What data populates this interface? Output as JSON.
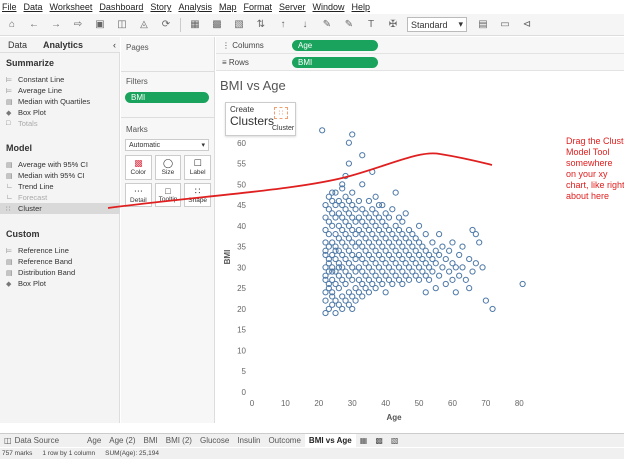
{
  "menu": [
    "File",
    "Data",
    "Worksheet",
    "Dashboard",
    "Story",
    "Analysis",
    "Map",
    "Format",
    "Server",
    "Window",
    "Help"
  ],
  "toolbar": {
    "fit_select": "Standard"
  },
  "left_tabs": {
    "data": "Data",
    "analytics": "Analytics"
  },
  "summarize": {
    "title": "Summarize",
    "items": [
      "Constant Line",
      "Average Line",
      "Median with Quartiles",
      "Box Plot",
      "Totals"
    ]
  },
  "model": {
    "title": "Model",
    "items": [
      "Average with 95% CI",
      "Median with 95% CI",
      "Trend Line",
      "Forecast",
      "Cluster"
    ]
  },
  "custom": {
    "title": "Custom",
    "items": [
      "Reference Line",
      "Reference Band",
      "Distribution Band",
      "Box Plot"
    ]
  },
  "pages": {
    "title": "Pages"
  },
  "filters": {
    "title": "Filters",
    "pill": "BMI"
  },
  "marks": {
    "title": "Marks",
    "type": "Automatic",
    "buttons": [
      "Color",
      "Size",
      "Label",
      "Detail",
      "Tooltip",
      "Shape"
    ]
  },
  "shelves": {
    "columns_label": "Columns",
    "columns_pill": "Age",
    "rows_label": "Rows",
    "rows_pill": "BMI"
  },
  "viz": {
    "title": "BMI vs Age",
    "drop_target": {
      "line1": "Create",
      "line2": "Clusters",
      "label": "Cluster"
    },
    "annotation": [
      "Drag the Cluster",
      "Model Tool",
      "somewhere",
      "on your xy",
      "chart, like right",
      "about here"
    ],
    "annotation_color": "#e02020",
    "mark_color": "#4e79a7"
  },
  "chart_data": {
    "type": "scatter",
    "title": "BMI vs Age",
    "xlabel": "Age",
    "ylabel": "BMI",
    "xlim": [
      0,
      85
    ],
    "ylim": [
      0,
      65
    ],
    "xticks": [
      0,
      10,
      20,
      30,
      40,
      50,
      60,
      70,
      80
    ],
    "yticks": [
      0,
      5,
      10,
      15,
      20,
      25,
      30,
      35,
      40,
      45,
      50,
      55,
      60
    ],
    "grid": false,
    "points": [
      [
        22,
        19
      ],
      [
        22,
        24
      ],
      [
        22,
        27
      ],
      [
        22,
        30
      ],
      [
        22,
        33
      ],
      [
        22,
        36
      ],
      [
        22,
        39
      ],
      [
        22,
        42
      ],
      [
        22,
        45
      ],
      [
        22,
        22
      ],
      [
        22,
        28
      ],
      [
        22,
        34
      ],
      [
        23,
        20
      ],
      [
        23,
        25
      ],
      [
        23,
        29
      ],
      [
        23,
        32
      ],
      [
        23,
        35
      ],
      [
        23,
        38
      ],
      [
        23,
        41
      ],
      [
        23,
        44
      ],
      [
        23,
        47
      ],
      [
        23,
        26
      ],
      [
        23,
        31
      ],
      [
        24,
        21
      ],
      [
        24,
        24
      ],
      [
        24,
        27
      ],
      [
        24,
        30
      ],
      [
        24,
        33
      ],
      [
        24,
        36
      ],
      [
        24,
        40
      ],
      [
        24,
        43
      ],
      [
        24,
        46
      ],
      [
        24,
        23
      ],
      [
        24,
        29
      ],
      [
        25,
        19
      ],
      [
        25,
        22
      ],
      [
        25,
        26
      ],
      [
        25,
        29
      ],
      [
        25,
        32
      ],
      [
        25,
        35
      ],
      [
        25,
        38
      ],
      [
        25,
        42
      ],
      [
        25,
        45
      ],
      [
        25,
        48
      ],
      [
        25,
        34
      ],
      [
        26,
        21
      ],
      [
        26,
        25
      ],
      [
        26,
        28
      ],
      [
        26,
        31
      ],
      [
        26,
        34
      ],
      [
        26,
        37
      ],
      [
        26,
        40
      ],
      [
        26,
        43
      ],
      [
        26,
        46
      ],
      [
        26,
        30
      ],
      [
        27,
        20
      ],
      [
        27,
        23
      ],
      [
        27,
        27
      ],
      [
        27,
        30
      ],
      [
        27,
        33
      ],
      [
        27,
        36
      ],
      [
        27,
        39
      ],
      [
        27,
        42
      ],
      [
        27,
        45
      ],
      [
        27,
        49
      ],
      [
        28,
        22
      ],
      [
        28,
        26
      ],
      [
        28,
        29
      ],
      [
        28,
        32
      ],
      [
        28,
        35
      ],
      [
        28,
        38
      ],
      [
        28,
        41
      ],
      [
        28,
        44
      ],
      [
        28,
        47
      ],
      [
        28,
        52
      ],
      [
        29,
        21
      ],
      [
        29,
        24
      ],
      [
        29,
        28
      ],
      [
        29,
        31
      ],
      [
        29,
        34
      ],
      [
        29,
        37
      ],
      [
        29,
        40
      ],
      [
        29,
        43
      ],
      [
        29,
        46
      ],
      [
        30,
        20
      ],
      [
        30,
        23
      ],
      [
        30,
        27
      ],
      [
        30,
        30
      ],
      [
        30,
        33
      ],
      [
        30,
        36
      ],
      [
        30,
        39
      ],
      [
        30,
        42
      ],
      [
        30,
        45
      ],
      [
        30,
        48
      ],
      [
        31,
        22
      ],
      [
        31,
        25
      ],
      [
        31,
        29
      ],
      [
        31,
        32
      ],
      [
        31,
        35
      ],
      [
        31,
        38
      ],
      [
        31,
        41
      ],
      [
        31,
        44
      ],
      [
        32,
        24
      ],
      [
        32,
        27
      ],
      [
        32,
        30
      ],
      [
        32,
        33
      ],
      [
        32,
        36
      ],
      [
        32,
        39
      ],
      [
        32,
        42
      ],
      [
        32,
        46
      ],
      [
        33,
        23
      ],
      [
        33,
        26
      ],
      [
        33,
        29
      ],
      [
        33,
        32
      ],
      [
        33,
        35
      ],
      [
        33,
        38
      ],
      [
        33,
        41
      ],
      [
        33,
        44
      ],
      [
        33,
        50
      ],
      [
        34,
        25
      ],
      [
        34,
        28
      ],
      [
        34,
        31
      ],
      [
        34,
        34
      ],
      [
        34,
        37
      ],
      [
        34,
        40
      ],
      [
        34,
        43
      ],
      [
        35,
        24
      ],
      [
        35,
        27
      ],
      [
        35,
        30
      ],
      [
        35,
        33
      ],
      [
        35,
        36
      ],
      [
        35,
        39
      ],
      [
        35,
        42
      ],
      [
        35,
        46
      ],
      [
        36,
        26
      ],
      [
        36,
        29
      ],
      [
        36,
        32
      ],
      [
        36,
        35
      ],
      [
        36,
        38
      ],
      [
        36,
        41
      ],
      [
        36,
        44
      ],
      [
        37,
        25
      ],
      [
        37,
        28
      ],
      [
        37,
        31
      ],
      [
        37,
        34
      ],
      [
        37,
        37
      ],
      [
        37,
        40
      ],
      [
        37,
        43
      ],
      [
        37,
        47
      ],
      [
        38,
        27
      ],
      [
        38,
        30
      ],
      [
        38,
        33
      ],
      [
        38,
        36
      ],
      [
        38,
        39
      ],
      [
        38,
        42
      ],
      [
        39,
        26
      ],
      [
        39,
        29
      ],
      [
        39,
        32
      ],
      [
        39,
        35
      ],
      [
        39,
        38
      ],
      [
        39,
        41
      ],
      [
        39,
        45
      ],
      [
        40,
        24
      ],
      [
        40,
        28
      ],
      [
        40,
        31
      ],
      [
        40,
        34
      ],
      [
        40,
        37
      ],
      [
        40,
        40
      ],
      [
        40,
        43
      ],
      [
        41,
        27
      ],
      [
        41,
        30
      ],
      [
        41,
        33
      ],
      [
        41,
        36
      ],
      [
        41,
        39
      ],
      [
        41,
        42
      ],
      [
        42,
        26
      ],
      [
        42,
        29
      ],
      [
        42,
        32
      ],
      [
        42,
        35
      ],
      [
        42,
        38
      ],
      [
        42,
        44
      ],
      [
        43,
        28
      ],
      [
        43,
        31
      ],
      [
        43,
        34
      ],
      [
        43,
        37
      ],
      [
        43,
        40
      ],
      [
        44,
        27
      ],
      [
        44,
        30
      ],
      [
        44,
        33
      ],
      [
        44,
        36
      ],
      [
        44,
        39
      ],
      [
        44,
        42
      ],
      [
        45,
        26
      ],
      [
        45,
        29
      ],
      [
        45,
        32
      ],
      [
        45,
        35
      ],
      [
        45,
        38
      ],
      [
        45,
        41
      ],
      [
        46,
        28
      ],
      [
        46,
        31
      ],
      [
        46,
        34
      ],
      [
        46,
        37
      ],
      [
        46,
        43
      ],
      [
        47,
        27
      ],
      [
        47,
        30
      ],
      [
        47,
        33
      ],
      [
        47,
        36
      ],
      [
        47,
        39
      ],
      [
        48,
        29
      ],
      [
        48,
        32
      ],
      [
        48,
        35
      ],
      [
        48,
        38
      ],
      [
        49,
        28
      ],
      [
        49,
        31
      ],
      [
        49,
        34
      ],
      [
        49,
        37
      ],
      [
        50,
        27
      ],
      [
        50,
        30
      ],
      [
        50,
        33
      ],
      [
        50,
        36
      ],
      [
        50,
        40
      ],
      [
        51,
        29
      ],
      [
        51,
        32
      ],
      [
        51,
        35
      ],
      [
        52,
        24
      ],
      [
        52,
        28
      ],
      [
        52,
        31
      ],
      [
        52,
        34
      ],
      [
        52,
        38
      ],
      [
        53,
        30
      ],
      [
        53,
        33
      ],
      [
        53,
        27
      ],
      [
        54,
        29
      ],
      [
        54,
        32
      ],
      [
        54,
        36
      ],
      [
        55,
        25
      ],
      [
        55,
        31
      ],
      [
        55,
        34
      ],
      [
        56,
        28
      ],
      [
        56,
        33
      ],
      [
        56,
        38
      ],
      [
        57,
        30
      ],
      [
        57,
        35
      ],
      [
        58,
        26
      ],
      [
        58,
        32
      ],
      [
        59,
        29
      ],
      [
        59,
        34
      ],
      [
        60,
        27
      ],
      [
        60,
        31
      ],
      [
        60,
        36
      ],
      [
        61,
        30
      ],
      [
        61,
        24
      ],
      [
        62,
        33
      ],
      [
        62,
        28
      ],
      [
        63,
        30
      ],
      [
        63,
        35
      ],
      [
        64,
        27
      ],
      [
        65,
        32
      ],
      [
        65,
        25
      ],
      [
        66,
        29
      ],
      [
        66,
        39
      ],
      [
        67,
        38
      ],
      [
        67,
        31
      ],
      [
        68,
        36
      ],
      [
        69,
        30
      ],
      [
        70,
        22
      ],
      [
        72,
        20
      ],
      [
        81,
        26
      ],
      [
        21,
        63
      ],
      [
        29,
        60
      ],
      [
        29,
        55
      ],
      [
        30,
        62
      ],
      [
        38,
        45
      ],
      [
        36,
        53
      ],
      [
        27,
        50
      ],
      [
        33,
        57
      ],
      [
        43,
        48
      ],
      [
        24,
        48
      ]
    ]
  },
  "bottom_tabs": [
    "Data Source",
    "Age",
    "Age (2)",
    "BMI",
    "BMI (2)",
    "Glucose",
    "Insulin",
    "Outcome",
    "BMI vs Age"
  ],
  "status": {
    "marks": "757 marks",
    "rows": "1 row by 1 column",
    "sum": "SUM(Age): 25,194"
  }
}
